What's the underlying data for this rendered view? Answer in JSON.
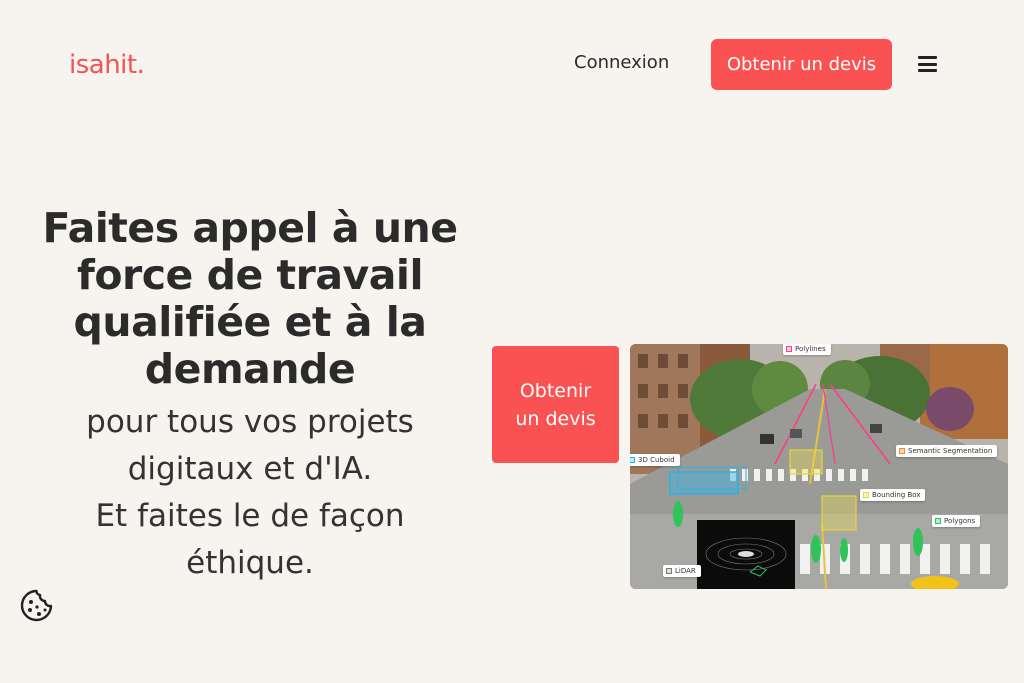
{
  "header": {
    "logo": "isahit.",
    "login_label": "Connexion",
    "quote_label": "Obtenir un devis"
  },
  "hero": {
    "title": "Faites appel à une force de travail qualifiée et à la demande",
    "subtitle": "pour tous vos projets\ndigitaux et d'IA.\nEt faites le de façon\néthique.",
    "cta_label": "Obtenir un devis"
  },
  "illustration": {
    "labels": {
      "polylines": "Polylines",
      "cuboid": "3D Cuboid",
      "semantic": "Semantic Segmentation",
      "bbox": "Bounding Box",
      "polygons": "Polygons",
      "lidar": "LiDAR"
    }
  },
  "colors": {
    "accent": "#fa5252",
    "logo": "#f25454",
    "background": "#f7f4f0"
  },
  "icons": {
    "menu": "hamburger-menu-icon",
    "cookie": "cookie-icon"
  }
}
